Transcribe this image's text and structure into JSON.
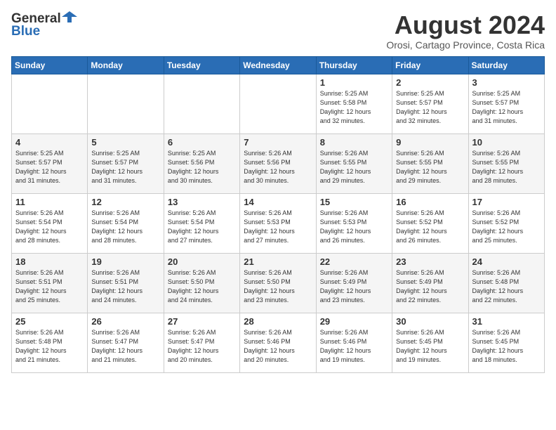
{
  "header": {
    "logo_general": "General",
    "logo_blue": "Blue",
    "month_year": "August 2024",
    "location": "Orosi, Cartago Province, Costa Rica"
  },
  "days_of_week": [
    "Sunday",
    "Monday",
    "Tuesday",
    "Wednesday",
    "Thursday",
    "Friday",
    "Saturday"
  ],
  "weeks": [
    [
      {
        "day": "",
        "info": ""
      },
      {
        "day": "",
        "info": ""
      },
      {
        "day": "",
        "info": ""
      },
      {
        "day": "",
        "info": ""
      },
      {
        "day": "1",
        "info": "Sunrise: 5:25 AM\nSunset: 5:58 PM\nDaylight: 12 hours\nand 32 minutes."
      },
      {
        "day": "2",
        "info": "Sunrise: 5:25 AM\nSunset: 5:57 PM\nDaylight: 12 hours\nand 32 minutes."
      },
      {
        "day": "3",
        "info": "Sunrise: 5:25 AM\nSunset: 5:57 PM\nDaylight: 12 hours\nand 31 minutes."
      }
    ],
    [
      {
        "day": "4",
        "info": "Sunrise: 5:25 AM\nSunset: 5:57 PM\nDaylight: 12 hours\nand 31 minutes."
      },
      {
        "day": "5",
        "info": "Sunrise: 5:25 AM\nSunset: 5:57 PM\nDaylight: 12 hours\nand 31 minutes."
      },
      {
        "day": "6",
        "info": "Sunrise: 5:25 AM\nSunset: 5:56 PM\nDaylight: 12 hours\nand 30 minutes."
      },
      {
        "day": "7",
        "info": "Sunrise: 5:26 AM\nSunset: 5:56 PM\nDaylight: 12 hours\nand 30 minutes."
      },
      {
        "day": "8",
        "info": "Sunrise: 5:26 AM\nSunset: 5:55 PM\nDaylight: 12 hours\nand 29 minutes."
      },
      {
        "day": "9",
        "info": "Sunrise: 5:26 AM\nSunset: 5:55 PM\nDaylight: 12 hours\nand 29 minutes."
      },
      {
        "day": "10",
        "info": "Sunrise: 5:26 AM\nSunset: 5:55 PM\nDaylight: 12 hours\nand 28 minutes."
      }
    ],
    [
      {
        "day": "11",
        "info": "Sunrise: 5:26 AM\nSunset: 5:54 PM\nDaylight: 12 hours\nand 28 minutes."
      },
      {
        "day": "12",
        "info": "Sunrise: 5:26 AM\nSunset: 5:54 PM\nDaylight: 12 hours\nand 28 minutes."
      },
      {
        "day": "13",
        "info": "Sunrise: 5:26 AM\nSunset: 5:54 PM\nDaylight: 12 hours\nand 27 minutes."
      },
      {
        "day": "14",
        "info": "Sunrise: 5:26 AM\nSunset: 5:53 PM\nDaylight: 12 hours\nand 27 minutes."
      },
      {
        "day": "15",
        "info": "Sunrise: 5:26 AM\nSunset: 5:53 PM\nDaylight: 12 hours\nand 26 minutes."
      },
      {
        "day": "16",
        "info": "Sunrise: 5:26 AM\nSunset: 5:52 PM\nDaylight: 12 hours\nand 26 minutes."
      },
      {
        "day": "17",
        "info": "Sunrise: 5:26 AM\nSunset: 5:52 PM\nDaylight: 12 hours\nand 25 minutes."
      }
    ],
    [
      {
        "day": "18",
        "info": "Sunrise: 5:26 AM\nSunset: 5:51 PM\nDaylight: 12 hours\nand 25 minutes."
      },
      {
        "day": "19",
        "info": "Sunrise: 5:26 AM\nSunset: 5:51 PM\nDaylight: 12 hours\nand 24 minutes."
      },
      {
        "day": "20",
        "info": "Sunrise: 5:26 AM\nSunset: 5:50 PM\nDaylight: 12 hours\nand 24 minutes."
      },
      {
        "day": "21",
        "info": "Sunrise: 5:26 AM\nSunset: 5:50 PM\nDaylight: 12 hours\nand 23 minutes."
      },
      {
        "day": "22",
        "info": "Sunrise: 5:26 AM\nSunset: 5:49 PM\nDaylight: 12 hours\nand 23 minutes."
      },
      {
        "day": "23",
        "info": "Sunrise: 5:26 AM\nSunset: 5:49 PM\nDaylight: 12 hours\nand 22 minutes."
      },
      {
        "day": "24",
        "info": "Sunrise: 5:26 AM\nSunset: 5:48 PM\nDaylight: 12 hours\nand 22 minutes."
      }
    ],
    [
      {
        "day": "25",
        "info": "Sunrise: 5:26 AM\nSunset: 5:48 PM\nDaylight: 12 hours\nand 21 minutes."
      },
      {
        "day": "26",
        "info": "Sunrise: 5:26 AM\nSunset: 5:47 PM\nDaylight: 12 hours\nand 21 minutes."
      },
      {
        "day": "27",
        "info": "Sunrise: 5:26 AM\nSunset: 5:47 PM\nDaylight: 12 hours\nand 20 minutes."
      },
      {
        "day": "28",
        "info": "Sunrise: 5:26 AM\nSunset: 5:46 PM\nDaylight: 12 hours\nand 20 minutes."
      },
      {
        "day": "29",
        "info": "Sunrise: 5:26 AM\nSunset: 5:46 PM\nDaylight: 12 hours\nand 19 minutes."
      },
      {
        "day": "30",
        "info": "Sunrise: 5:26 AM\nSunset: 5:45 PM\nDaylight: 12 hours\nand 19 minutes."
      },
      {
        "day": "31",
        "info": "Sunrise: 5:26 AM\nSunset: 5:45 PM\nDaylight: 12 hours\nand 18 minutes."
      }
    ]
  ]
}
